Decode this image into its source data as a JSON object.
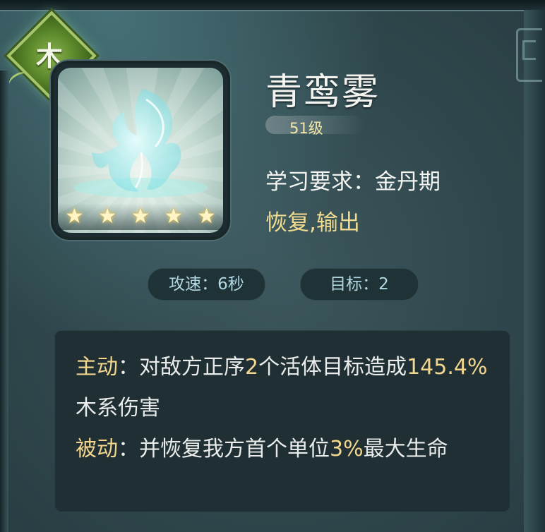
{
  "element": {
    "label": "木",
    "color": "#5d8a2c"
  },
  "skill": {
    "name": "青鸾雾",
    "level": "51级",
    "requirement": "学习要求：金丹期",
    "tags": "恢复,输出",
    "stars": 5,
    "icon": "phoenix-icon"
  },
  "stats": {
    "attack_speed": "攻速：6秒",
    "targets": "目标：2"
  },
  "description": {
    "active_label": "主动",
    "active_parts": [
      "：对敌方正序",
      "2",
      "个活体目标造成",
      "145.4%",
      "木系伤害"
    ],
    "passive_label": "被动",
    "passive_parts": [
      "：并恢复我方首个单位",
      "3%",
      "最大生命"
    ]
  },
  "colors": {
    "highlight": "#f2d58e",
    "panel": "#1f2f33",
    "background": "#2f474c"
  }
}
